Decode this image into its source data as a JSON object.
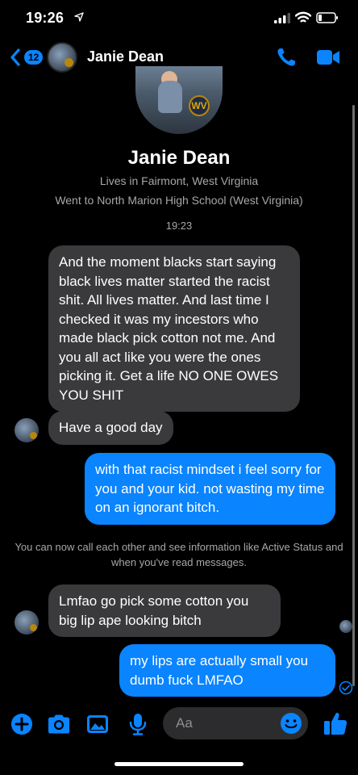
{
  "status_bar": {
    "time": "19:26"
  },
  "header": {
    "back_count": "12",
    "name": "Janie Dean"
  },
  "profile": {
    "name": "Janie Dean",
    "lives": "Lives in Fairmont, West Virginia",
    "school": "Went to North Marion High School (West Virginia)",
    "logo_text": "WV"
  },
  "timestamp": "19:23",
  "messages": [
    {
      "direction": "incoming",
      "text": "And the moment blacks start saying black lives matter started the racist shit. All lives matter. And last time I checked it was my incestors who made black pick cotton not me. And you all act like you were the ones picking it. Get a life NO ONE OWES YOU SHIT"
    },
    {
      "direction": "incoming",
      "text": "Have a good day"
    },
    {
      "direction": "outgoing",
      "text": "with that racist mindset i feel sorry for you and your kid. not wasting my time on an ignorant bitch."
    },
    {
      "direction": "incoming",
      "text": "Lmfao go pick some cotton you big lip ape looking bitch"
    },
    {
      "direction": "outgoing",
      "text": "my lips are actually small you dumb fuck LMFAO"
    }
  ],
  "system_message": "You can now call each other and see information like Active Status and when you've read messages.",
  "composer": {
    "placeholder": "Aa"
  },
  "colors": {
    "accent": "#0a84ff",
    "incoming_bubble": "#3a3a3c",
    "background": "#000000",
    "secondary_text": "#a7a7a7"
  },
  "icons": [
    "location-arrow-icon",
    "signal-icon",
    "wifi-icon",
    "battery-icon",
    "back-chevron-icon",
    "phone-icon",
    "video-camera-icon",
    "plus-icon",
    "camera-icon",
    "photo-icon",
    "microphone-icon",
    "emoji-icon",
    "thumbs-up-icon",
    "delivered-check-icon"
  ]
}
